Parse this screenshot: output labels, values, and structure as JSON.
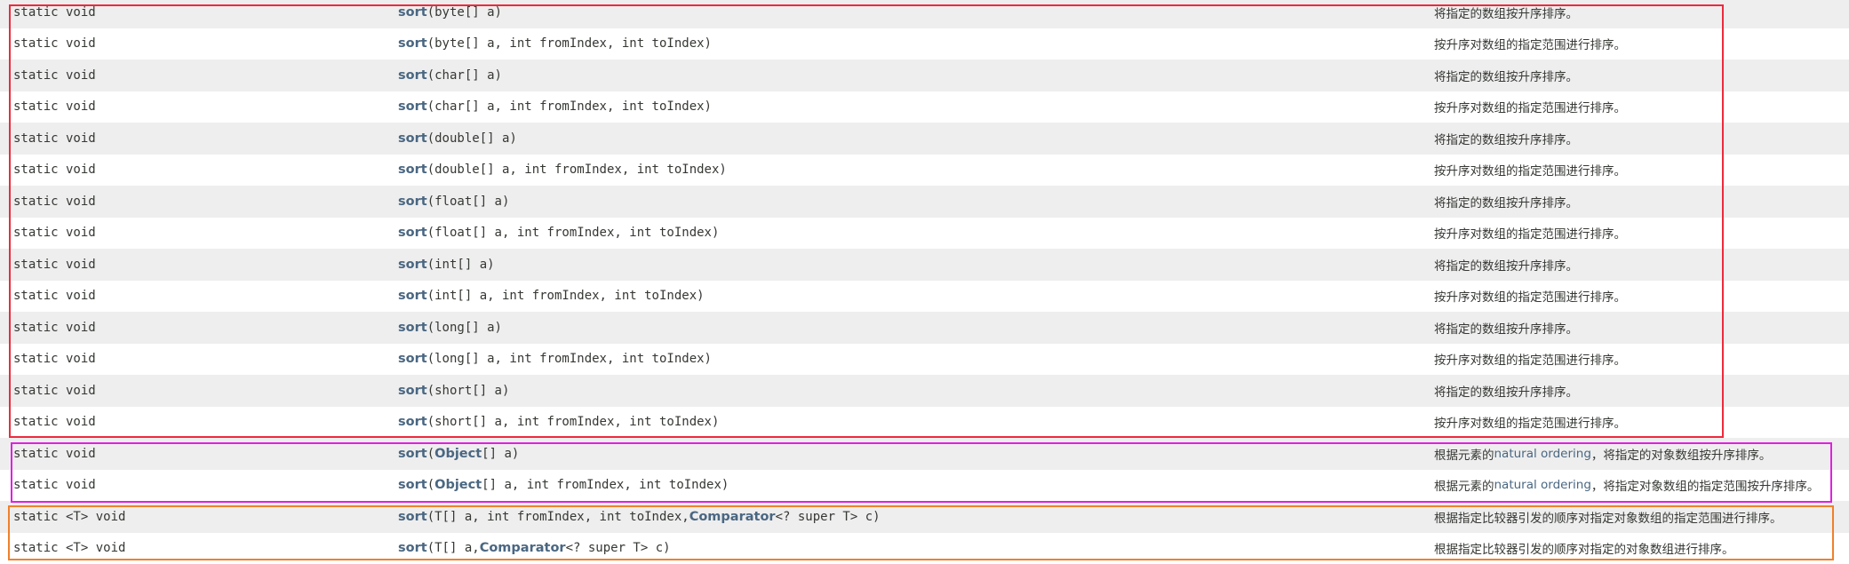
{
  "highlight_colors": {
    "primitive_group": "#ee2a3c",
    "object_group": "#e020e0",
    "generic_group": "#f0802a"
  },
  "rows": [
    {
      "modifier": "static void",
      "method": "sort",
      "params": "(byte[] a)",
      "description": "将指定的数组按升序排序。"
    },
    {
      "modifier": "static void",
      "method": "sort",
      "params": "(byte[] a, int fromIndex, int toIndex)",
      "description": "按升序对数组的指定范围进行排序。"
    },
    {
      "modifier": "static void",
      "method": "sort",
      "params": "(char[] a)",
      "description": "将指定的数组按升序排序。"
    },
    {
      "modifier": "static void",
      "method": "sort",
      "params": "(char[] a, int fromIndex, int toIndex)",
      "description": "按升序对数组的指定范围进行排序。"
    },
    {
      "modifier": "static void",
      "method": "sort",
      "params": "(double[] a)",
      "description": "将指定的数组按升序排序。"
    },
    {
      "modifier": "static void",
      "method": "sort",
      "params": "(double[] a, int fromIndex, int toIndex)",
      "description": "按升序对数组的指定范围进行排序。"
    },
    {
      "modifier": "static void",
      "method": "sort",
      "params": "(float[] a)",
      "description": "将指定的数组按升序排序。"
    },
    {
      "modifier": "static void",
      "method": "sort",
      "params": "(float[] a, int fromIndex, int toIndex)",
      "description": "按升序对数组的指定范围进行排序。"
    },
    {
      "modifier": "static void",
      "method": "sort",
      "params": "(int[] a)",
      "description": "将指定的数组按升序排序。"
    },
    {
      "modifier": "static void",
      "method": "sort",
      "params": "(int[] a, int fromIndex, int toIndex)",
      "description": "按升序对数组的指定范围进行排序。"
    },
    {
      "modifier": "static void",
      "method": "sort",
      "params": "(long[] a)",
      "description": "将指定的数组按升序排序。"
    },
    {
      "modifier": "static void",
      "method": "sort",
      "params": "(long[] a, int fromIndex, int toIndex)",
      "description": "按升序对数组的指定范围进行排序。"
    },
    {
      "modifier": "static void",
      "method": "sort",
      "params": "(short[] a)",
      "description": "将指定的数组按升序排序。"
    },
    {
      "modifier": "static void",
      "method": "sort",
      "params": "(short[] a, int fromIndex, int toIndex)",
      "description": "按升序对数组的指定范围进行排序。"
    },
    {
      "modifier": "static void",
      "method": "sort",
      "params_pre": "(",
      "type_link": "Object",
      "params_post": "[] a)",
      "desc_pre": "根据元素的",
      "desc_link": "natural ordering",
      "desc_post": " ，将指定的对象数组按升序排序。"
    },
    {
      "modifier": "static void",
      "method": "sort",
      "params_pre": "(",
      "type_link": "Object",
      "params_post": "[] a, int fromIndex, int toIndex)",
      "desc_pre": "根据元素的",
      "desc_link": "natural ordering",
      "desc_post": " ，将指定对象数组的指定范围按升序排序。"
    },
    {
      "modifier": "static <T> void",
      "method": "sort",
      "params_pre": "(T[] a, int fromIndex, int toIndex, ",
      "type_link": "Comparator",
      "params_post": "<? super T> c)",
      "description": "根据指定比较器引发的顺序对指定对象数组的指定范围进行排序。"
    },
    {
      "modifier": "static <T> void",
      "method": "sort",
      "params_pre": "(T[] a, ",
      "type_link": "Comparator",
      "params_post": "<? super T> c)",
      "description": "根据指定比较器引发的顺序对指定的对象数组进行排序。"
    }
  ]
}
